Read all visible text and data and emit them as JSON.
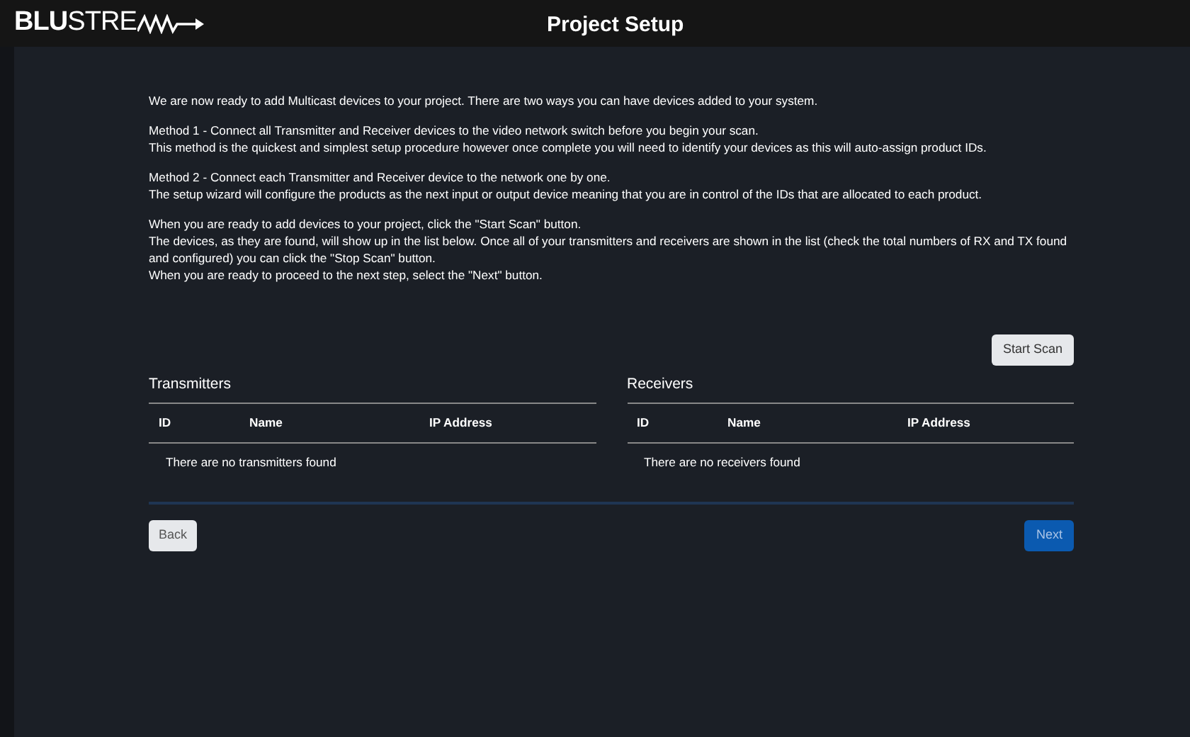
{
  "header": {
    "logo_bold": "BLU",
    "logo_light": "STRE",
    "title": "Project Setup"
  },
  "paragraphs": [
    [
      "We are now ready to add Multicast devices to your project. There are two ways you can have devices added to your system."
    ],
    [
      "Method 1 - Connect all Transmitter and Receiver devices to the video network switch before you begin your scan.",
      "This method is the quickest and simplest setup procedure however once complete you will need to identify your devices as this will auto-assign product IDs."
    ],
    [
      "Method 2 - Connect each Transmitter and Receiver device to the network one by one.",
      "The setup wizard will configure the products as the next input or output device meaning that you are in control of the IDs that are allocated to each product."
    ],
    [
      "When you are ready to add devices to your project, click the \"Start Scan\" button.",
      "The devices, as they are found, will show up in the list below. Once all of your transmitters and receivers are shown in the list (check the total numbers of RX and TX found and configured) you can click the \"Stop Scan\" button.",
      "When you are ready to proceed to the next step, select the \"Next\" button."
    ]
  ],
  "scan_button": "Start Scan",
  "tables": [
    {
      "title": "Transmitters",
      "columns": [
        "ID",
        "Name",
        "IP Address"
      ],
      "empty": "There are no transmitters found"
    },
    {
      "title": "Receivers",
      "columns": [
        "ID",
        "Name",
        "IP Address"
      ],
      "empty": "There are no receivers found"
    }
  ],
  "back_button": "Back",
  "next_button": "Next"
}
